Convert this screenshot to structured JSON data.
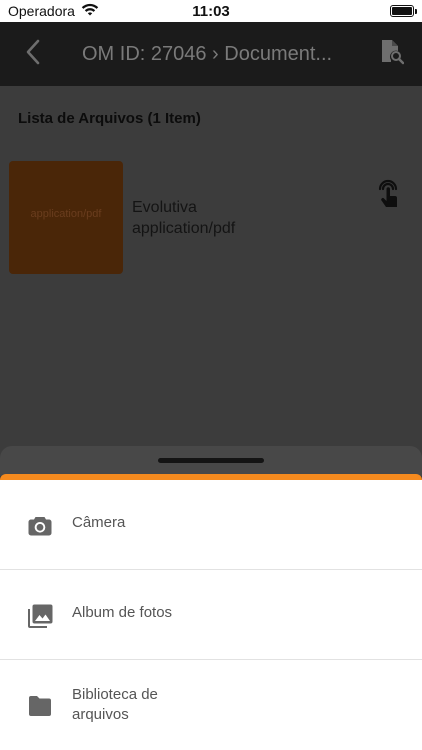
{
  "status_bar": {
    "carrier": "Operadora",
    "time": "11:03"
  },
  "header": {
    "title": "OM ID: 27046 › Document..."
  },
  "content": {
    "list_title": "Lista de Arquivos (1 Item)",
    "files": [
      {
        "thumbnail_label": "application/pdf",
        "name": "Evolutiva",
        "type": "application/pdf"
      }
    ]
  },
  "sheet": {
    "accent_color": "#f58a1e",
    "options": [
      {
        "label": "Câmera",
        "icon": "camera-icon"
      },
      {
        "label": "Album de fotos",
        "icon": "photo-library-icon"
      },
      {
        "label": "Biblioteca de arquivos",
        "icon": "folder-icon"
      }
    ]
  }
}
